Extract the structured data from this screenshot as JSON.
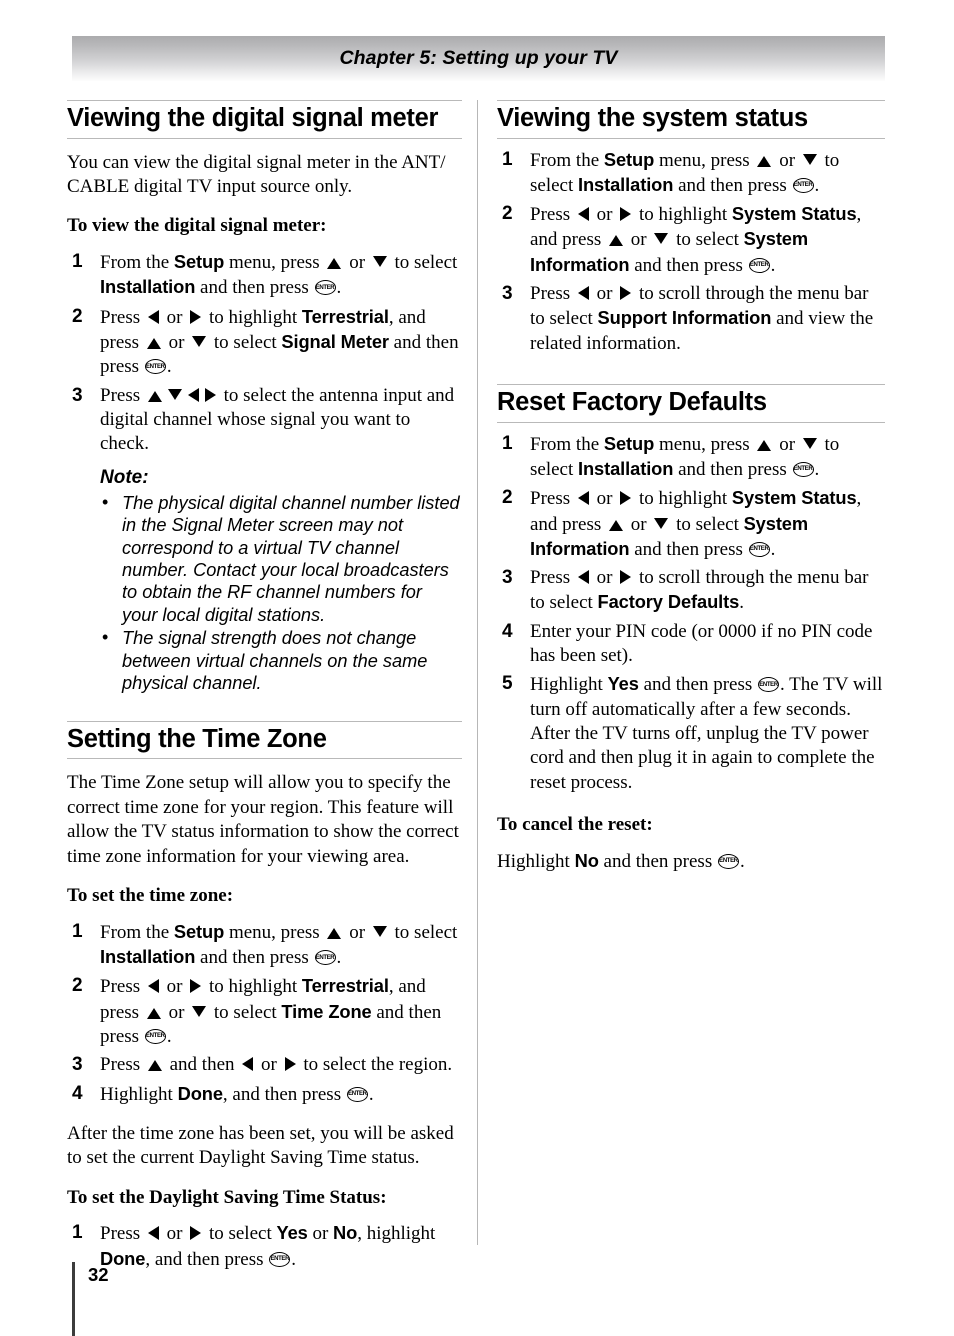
{
  "header": {
    "chapter_title": "Chapter 5: Setting up your TV"
  },
  "icons": {
    "enter_label": "ENTER",
    "bullet": "•"
  },
  "left_column": {
    "sections": [
      {
        "heading": "Viewing the digital signal meter",
        "intro": "You can view the digital signal meter in the ANT/ CABLE digital TV input source only.",
        "subheading": "To view the digital signal meter:",
        "steps": [
          {
            "num": "1",
            "parts": [
              {
                "t": "text",
                "v": "From the "
              },
              {
                "t": "ui",
                "v": "Setup"
              },
              {
                "t": "text",
                "v": " menu, press "
              },
              {
                "t": "arrow",
                "v": "up"
              },
              {
                "t": "text",
                "v": " or "
              },
              {
                "t": "arrow",
                "v": "down"
              },
              {
                "t": "text",
                "v": " to select "
              },
              {
                "t": "ui",
                "v": "Installation"
              },
              {
                "t": "text",
                "v": " and then press "
              },
              {
                "t": "enter",
                "v": "ENTER"
              },
              {
                "t": "text",
                "v": "."
              }
            ]
          },
          {
            "num": "2",
            "parts": [
              {
                "t": "text",
                "v": "Press "
              },
              {
                "t": "arrow",
                "v": "left"
              },
              {
                "t": "text",
                "v": " or "
              },
              {
                "t": "arrow",
                "v": "right"
              },
              {
                "t": "text",
                "v": " to highlight "
              },
              {
                "t": "ui",
                "v": "Terrestrial"
              },
              {
                "t": "text",
                "v": ", and press "
              },
              {
                "t": "arrow",
                "v": "up"
              },
              {
                "t": "text",
                "v": " or "
              },
              {
                "t": "arrow",
                "v": "down"
              },
              {
                "t": "text",
                "v": " to select "
              },
              {
                "t": "ui",
                "v": "Signal Meter"
              },
              {
                "t": "text",
                "v": " and then press "
              },
              {
                "t": "enter",
                "v": "ENTER"
              },
              {
                "t": "text",
                "v": "."
              }
            ]
          },
          {
            "num": "3",
            "parts": [
              {
                "t": "text",
                "v": "Press "
              },
              {
                "t": "arrow",
                "v": "up"
              },
              {
                "t": "arrow",
                "v": "down"
              },
              {
                "t": "arrow",
                "v": "left"
              },
              {
                "t": "arrow",
                "v": "right"
              },
              {
                "t": "text",
                "v": " to select the antenna input and digital channel whose signal you want to check."
              }
            ]
          }
        ],
        "note": {
          "title": "Note:",
          "items": [
            "The physical digital channel number listed in the Signal Meter screen may not correspond to a virtual TV channel number. Contact your local broadcasters to obtain the RF channel numbers for your local digital stations.",
            "The signal strength does not change between virtual channels on the same physical channel."
          ]
        }
      },
      {
        "heading": "Setting the Time Zone",
        "intro": "The Time Zone setup will allow you to specify the correct time zone for your region. This feature will allow the TV status information to show the correct time zone information for your viewing area.",
        "subheading": "To set the time zone:",
        "steps": [
          {
            "num": "1",
            "parts": [
              {
                "t": "text",
                "v": "From the "
              },
              {
                "t": "ui",
                "v": "Setup"
              },
              {
                "t": "text",
                "v": " menu, press "
              },
              {
                "t": "arrow",
                "v": "up"
              },
              {
                "t": "text",
                "v": " or "
              },
              {
                "t": "arrow",
                "v": "down"
              },
              {
                "t": "text",
                "v": " to select "
              },
              {
                "t": "ui",
                "v": "Installation"
              },
              {
                "t": "text",
                "v": " and then press "
              },
              {
                "t": "enter",
                "v": "ENTER"
              },
              {
                "t": "text",
                "v": "."
              }
            ]
          },
          {
            "num": "2",
            "parts": [
              {
                "t": "text",
                "v": "Press "
              },
              {
                "t": "arrow",
                "v": "left"
              },
              {
                "t": "text",
                "v": " or "
              },
              {
                "t": "arrow",
                "v": "right"
              },
              {
                "t": "text",
                "v": " to highlight "
              },
              {
                "t": "ui",
                "v": "Terrestrial"
              },
              {
                "t": "text",
                "v": ", and press "
              },
              {
                "t": "arrow",
                "v": "up"
              },
              {
                "t": "text",
                "v": " or "
              },
              {
                "t": "arrow",
                "v": "down"
              },
              {
                "t": "text",
                "v": " to select "
              },
              {
                "t": "ui",
                "v": "Time Zone"
              },
              {
                "t": "text",
                "v": " and then press "
              },
              {
                "t": "enter",
                "v": "ENTER"
              },
              {
                "t": "text",
                "v": "."
              }
            ]
          },
          {
            "num": "3",
            "parts": [
              {
                "t": "text",
                "v": "Press "
              },
              {
                "t": "arrow",
                "v": "up"
              },
              {
                "t": "text",
                "v": " and then "
              },
              {
                "t": "arrow",
                "v": "left"
              },
              {
                "t": "text",
                "v": " or "
              },
              {
                "t": "arrow",
                "v": "right"
              },
              {
                "t": "text",
                "v": " to select the region."
              }
            ]
          },
          {
            "num": "4",
            "parts": [
              {
                "t": "text",
                "v": "Highlight "
              },
              {
                "t": "ui",
                "v": "Done"
              },
              {
                "t": "text",
                "v": ", and then press "
              },
              {
                "t": "enter",
                "v": "ENTER"
              },
              {
                "t": "text",
                "v": "."
              }
            ]
          }
        ],
        "after_text": "After the time zone has been set, you will be asked to set the current Daylight Saving Time status.",
        "subheading2": "To set the Daylight Saving Time Status:",
        "steps2": [
          {
            "num": "1",
            "parts": [
              {
                "t": "text",
                "v": "Press "
              },
              {
                "t": "arrow",
                "v": "left"
              },
              {
                "t": "text",
                "v": " or "
              },
              {
                "t": "arrow",
                "v": "right"
              },
              {
                "t": "text",
                "v": " to select "
              },
              {
                "t": "ui",
                "v": "Yes"
              },
              {
                "t": "text",
                "v": " or "
              },
              {
                "t": "ui",
                "v": "No"
              },
              {
                "t": "text",
                "v": ", highlight "
              },
              {
                "t": "ui",
                "v": "Done"
              },
              {
                "t": "text",
                "v": ", and then press "
              },
              {
                "t": "enter",
                "v": "ENTER"
              },
              {
                "t": "text",
                "v": "."
              }
            ]
          }
        ]
      }
    ]
  },
  "right_column": {
    "sections": [
      {
        "heading": "Viewing the system status",
        "steps": [
          {
            "num": "1",
            "parts": [
              {
                "t": "text",
                "v": "From the "
              },
              {
                "t": "ui",
                "v": "Setup"
              },
              {
                "t": "text",
                "v": " menu, press "
              },
              {
                "t": "arrow",
                "v": "up"
              },
              {
                "t": "text",
                "v": " or "
              },
              {
                "t": "arrow",
                "v": "down"
              },
              {
                "t": "text",
                "v": " to select "
              },
              {
                "t": "ui",
                "v": "Installation"
              },
              {
                "t": "text",
                "v": " and then press "
              },
              {
                "t": "enter",
                "v": "ENTER"
              },
              {
                "t": "text",
                "v": "."
              }
            ]
          },
          {
            "num": "2",
            "parts": [
              {
                "t": "text",
                "v": "Press "
              },
              {
                "t": "arrow",
                "v": "left"
              },
              {
                "t": "text",
                "v": " or "
              },
              {
                "t": "arrow",
                "v": "right"
              },
              {
                "t": "text",
                "v": " to highlight "
              },
              {
                "t": "ui",
                "v": "System Status"
              },
              {
                "t": "text",
                "v": ", and press "
              },
              {
                "t": "arrow",
                "v": "up"
              },
              {
                "t": "text",
                "v": " or "
              },
              {
                "t": "arrow",
                "v": "down"
              },
              {
                "t": "text",
                "v": " to select "
              },
              {
                "t": "ui",
                "v": "System Information"
              },
              {
                "t": "text",
                "v": " and then press "
              },
              {
                "t": "enter",
                "v": "ENTER"
              },
              {
                "t": "text",
                "v": "."
              }
            ]
          },
          {
            "num": "3",
            "parts": [
              {
                "t": "text",
                "v": "Press "
              },
              {
                "t": "arrow",
                "v": "left"
              },
              {
                "t": "text",
                "v": " or "
              },
              {
                "t": "arrow",
                "v": "right"
              },
              {
                "t": "text",
                "v": " to scroll through the menu bar to select "
              },
              {
                "t": "ui",
                "v": "Support Information"
              },
              {
                "t": "text",
                "v": " and view the related information."
              }
            ]
          }
        ]
      },
      {
        "heading": "Reset Factory Defaults",
        "steps": [
          {
            "num": "1",
            "parts": [
              {
                "t": "text",
                "v": "From the "
              },
              {
                "t": "ui",
                "v": "Setup"
              },
              {
                "t": "text",
                "v": " menu, press "
              },
              {
                "t": "arrow",
                "v": "up"
              },
              {
                "t": "text",
                "v": " or "
              },
              {
                "t": "arrow",
                "v": "down"
              },
              {
                "t": "text",
                "v": " to select "
              },
              {
                "t": "ui",
                "v": "Installation"
              },
              {
                "t": "text",
                "v": " and then press "
              },
              {
                "t": "enter",
                "v": "ENTER"
              },
              {
                "t": "text",
                "v": "."
              }
            ]
          },
          {
            "num": "2",
            "parts": [
              {
                "t": "text",
                "v": "Press "
              },
              {
                "t": "arrow",
                "v": "left"
              },
              {
                "t": "text",
                "v": " or "
              },
              {
                "t": "arrow",
                "v": "right"
              },
              {
                "t": "text",
                "v": " to highlight "
              },
              {
                "t": "ui",
                "v": "System Status"
              },
              {
                "t": "text",
                "v": ", and press "
              },
              {
                "t": "arrow",
                "v": "up"
              },
              {
                "t": "text",
                "v": " or "
              },
              {
                "t": "arrow",
                "v": "down"
              },
              {
                "t": "text",
                "v": " to select "
              },
              {
                "t": "ui",
                "v": "System Information"
              },
              {
                "t": "text",
                "v": " and then press "
              },
              {
                "t": "enter",
                "v": "ENTER"
              },
              {
                "t": "text",
                "v": "."
              }
            ]
          },
          {
            "num": "3",
            "parts": [
              {
                "t": "text",
                "v": "Press "
              },
              {
                "t": "arrow",
                "v": "left"
              },
              {
                "t": "text",
                "v": " or "
              },
              {
                "t": "arrow",
                "v": "right"
              },
              {
                "t": "text",
                "v": " to scroll through the menu bar to select "
              },
              {
                "t": "ui",
                "v": "Factory Defaults"
              },
              {
                "t": "text",
                "v": "."
              }
            ]
          },
          {
            "num": "4",
            "parts": [
              {
                "t": "text",
                "v": "Enter your PIN code (or 0000 if no PIN code has been set)."
              }
            ]
          },
          {
            "num": "5",
            "parts": [
              {
                "t": "text",
                "v": "Highlight "
              },
              {
                "t": "ui",
                "v": "Yes"
              },
              {
                "t": "text",
                "v": " and then press "
              },
              {
                "t": "enter",
                "v": "ENTER"
              },
              {
                "t": "text",
                "v": ". The TV will turn off automatically after a few seconds. After the TV turns off, unplug the TV power cord and then plug it in again to complete the reset process."
              }
            ]
          }
        ],
        "subheading": "To cancel the reset:",
        "closing_parts": [
          {
            "t": "text",
            "v": "Highlight "
          },
          {
            "t": "ui",
            "v": "No"
          },
          {
            "t": "text",
            "v": " and then press "
          },
          {
            "t": "enter",
            "v": "ENTER"
          },
          {
            "t": "text",
            "v": "."
          }
        ]
      }
    ]
  },
  "footer": {
    "page_number": "32"
  }
}
